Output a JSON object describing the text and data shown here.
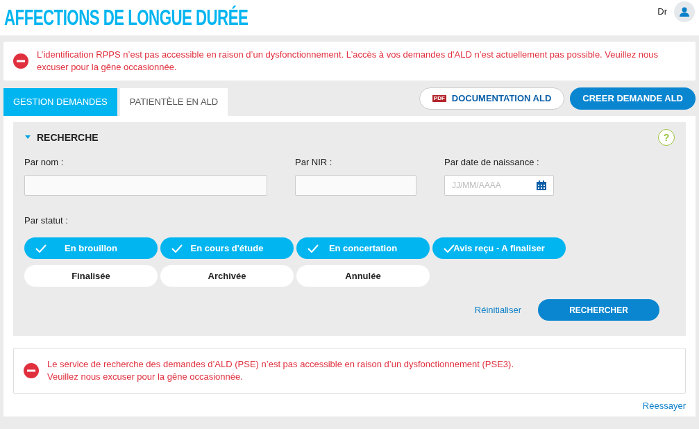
{
  "header": {
    "title": "AFFECTIONS DE LONGUE DURÉE",
    "user": "Dr"
  },
  "alert": {
    "text": "L’identification RPPS n’est pas accessible en raison d’un dysfonctionnement. L’accès à vos demandes d'ALD n’est actuellement pas possible. Veuillez nous excuser pour la gêne occasionnée."
  },
  "tabs": [
    {
      "label": "GESTION DEMANDES",
      "selected": true
    },
    {
      "label": "PATIENTÈLE EN ALD",
      "selected": false
    }
  ],
  "actions": [
    {
      "label": "DOCUMENTATION ALD",
      "kind": "outline",
      "badge": "PDF"
    },
    {
      "label": "CREER DEMANDE ALD",
      "kind": "primary"
    }
  ],
  "search": {
    "title": "RECHERCHE",
    "expanded": true,
    "help": "?",
    "fields": [
      {
        "label": "Par nom :",
        "kind": "text"
      },
      {
        "label": "Par NIR :",
        "kind": "text"
      },
      {
        "label": "Par date de naissance :",
        "kind": "date",
        "placeholder": "JJ/MM/AAAA"
      }
    ],
    "status_label": "Par statut :",
    "statuses": [
      {
        "label": "En brouillon",
        "checked": true
      },
      {
        "label": "En cours d'étude",
        "checked": true
      },
      {
        "label": "En concertation",
        "checked": true
      },
      {
        "label": "Avis reçu - A finaliser",
        "checked": true
      },
      {
        "label": "Finalisée",
        "checked": false
      },
      {
        "label": "Archivée",
        "checked": false
      },
      {
        "label": "Annulée",
        "checked": false
      }
    ],
    "reset": "Réinitialiser",
    "submit": "RECHERCHER"
  },
  "error": {
    "lines": [
      "Le service de recherche des demandes d’ALD (PSE) n’est pas accessible en raison d’un dysfonctionnement (PSE3).",
      "Veuillez nous excuser pour la gêne occasionnée."
    ]
  },
  "retry": "Réessayer"
}
